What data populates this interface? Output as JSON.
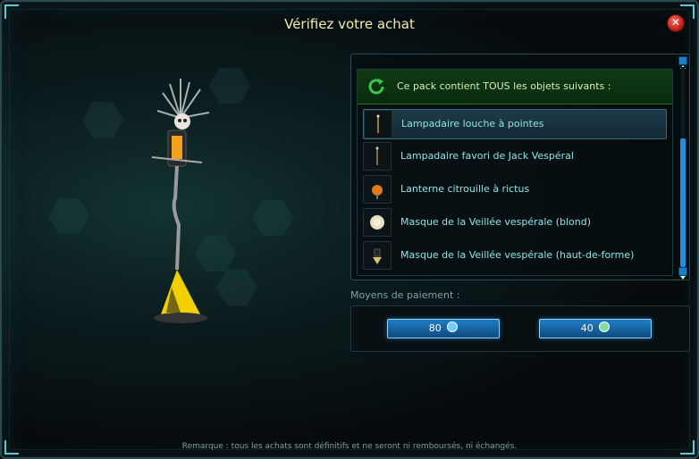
{
  "window": {
    "title": "Vérifiez votre achat",
    "close_label": "✕"
  },
  "pack": {
    "header_label": "Ce pack contient TOUS les objets suivants :",
    "items": [
      {
        "label": "Lampadaire louche à pointes",
        "icon": "lamp-post-icon",
        "selected": true
      },
      {
        "label": "Lampadaire favori de Jack Vespéral",
        "icon": "lamp-post-icon",
        "selected": false
      },
      {
        "label": "Lanterne citrouille à rictus",
        "icon": "pumpkin-lantern-icon",
        "selected": false
      },
      {
        "label": "Masque de la Veillée vespérale (blond)",
        "icon": "mask-blond-icon",
        "selected": false
      },
      {
        "label": "Masque de la Veillée vespérale (haut-de-forme)",
        "icon": "mask-tophat-icon",
        "selected": false
      }
    ]
  },
  "payment": {
    "label": "Moyens de paiement :",
    "options": [
      {
        "amount": "80",
        "currency_icon": "cash-currency-icon",
        "color": "#6fd0ff"
      },
      {
        "amount": "40",
        "currency_icon": "token-currency-icon",
        "color": "#7fe0a0"
      }
    ]
  },
  "note": "Remarque : tous les achats sont définitifs et ne seront ni remboursés, ni échangés."
}
